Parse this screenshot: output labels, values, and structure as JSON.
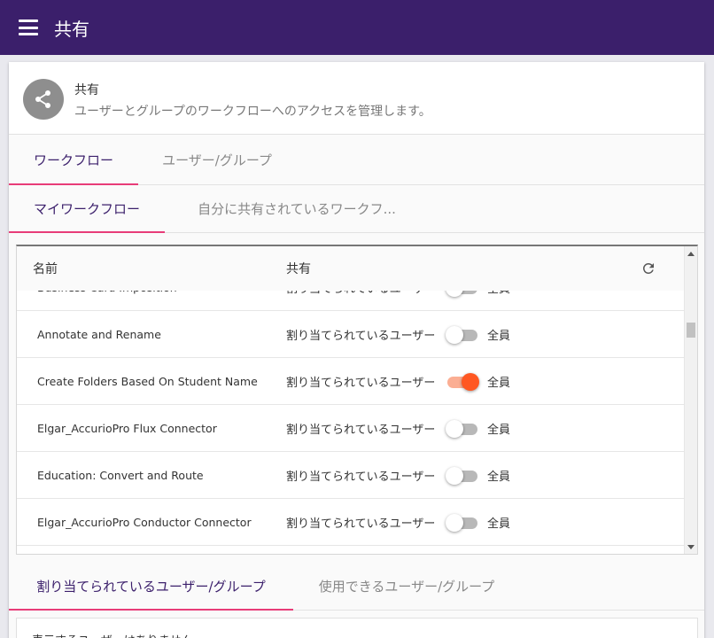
{
  "appbar": {
    "title": "共有"
  },
  "header": {
    "title": "共有",
    "subtitle": "ユーザーとグループのワークフローへのアクセスを管理します。"
  },
  "main_tabs": [
    {
      "label": "ワークフロー",
      "active": true
    },
    {
      "label": "ユーザー/グループ",
      "active": false
    }
  ],
  "sub_tabs": [
    {
      "label": "マイワークフロー",
      "active": true
    },
    {
      "label": "自分に共有されているワークフ...",
      "active": false
    }
  ],
  "table": {
    "columns": {
      "name": "名前",
      "share": "共有"
    },
    "rows": [
      {
        "name": "Business Card Imposition",
        "assigned": "割り当てられているユーザー",
        "all_enabled": false,
        "all_label": "全員"
      },
      {
        "name": "Annotate and Rename",
        "assigned": "割り当てられているユーザー",
        "all_enabled": false,
        "all_label": "全員"
      },
      {
        "name": "Create Folders Based On Student Name",
        "assigned": "割り当てられているユーザー",
        "all_enabled": true,
        "all_label": "全員"
      },
      {
        "name": "Elgar_AccurioPro Flux Connector",
        "assigned": "割り当てられているユーザー",
        "all_enabled": false,
        "all_label": "全員"
      },
      {
        "name": "Education: Convert and Route",
        "assigned": "割り当てられているユーザー",
        "all_enabled": false,
        "all_label": "全員"
      },
      {
        "name": "Elgar_AccurioPro Conductor Connector",
        "assigned": "割り当てられているユーザー",
        "all_enabled": false,
        "all_label": "全員"
      }
    ]
  },
  "user_tabs": [
    {
      "label": "割り当てられているユーザー/グループ",
      "active": true
    },
    {
      "label": "使用できるユーザー/グループ",
      "active": false
    }
  ],
  "users_panel": {
    "empty_text": "表示するユーザーはありません"
  },
  "colors": {
    "appbar": "#3b1f6b",
    "accent": "#e83c78",
    "toggle_on": "#ff5722"
  }
}
